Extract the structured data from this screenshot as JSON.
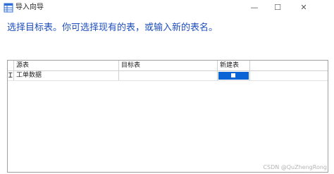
{
  "window": {
    "title": "导入向导",
    "minimize_glyph": "—",
    "maximize_glyph": "☐",
    "close_glyph": "✕"
  },
  "instruction": "选择目标表。你可选择现有的表，或输入新的表名。",
  "table": {
    "columns": [
      "源表",
      "目标表",
      "新建表"
    ],
    "rows": [
      {
        "source": "工单数据",
        "target": "",
        "new_table_checked": false
      }
    ]
  },
  "watermark": "CSDN @QuZhengRong",
  "colors": {
    "instruction": "#1f4fbf",
    "selection": "#0a64d6"
  }
}
